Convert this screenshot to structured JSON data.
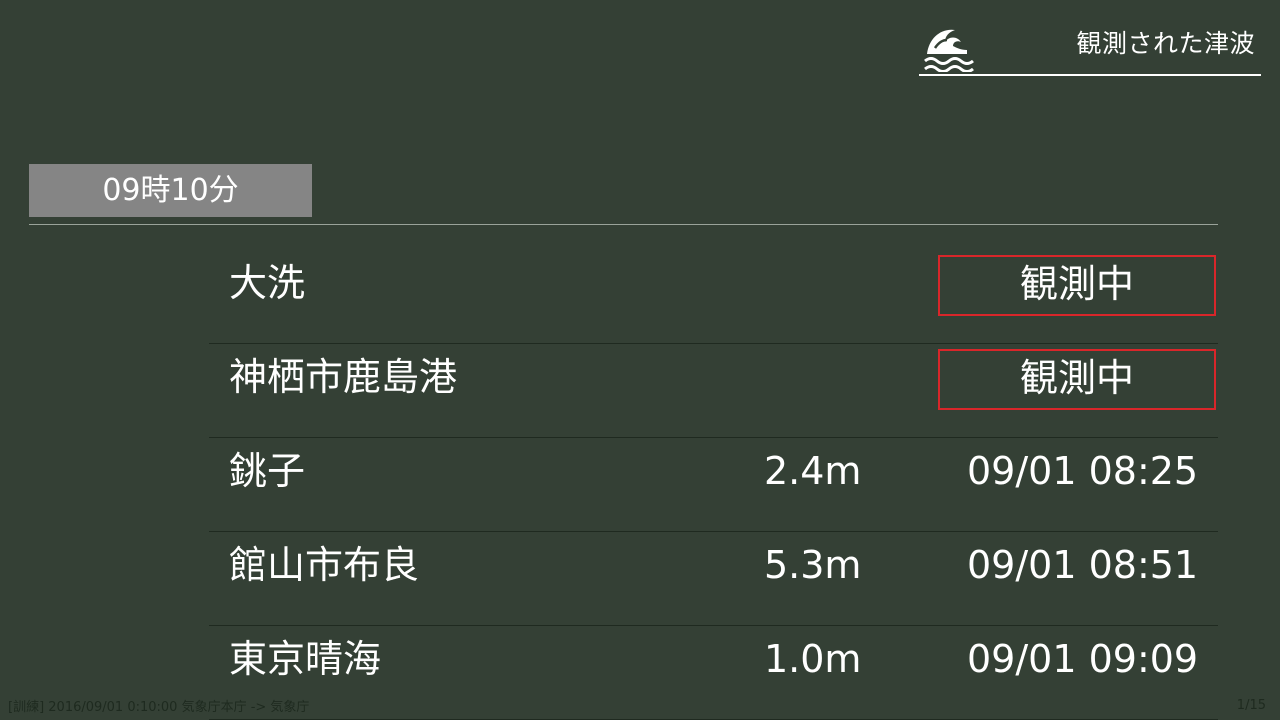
{
  "header": {
    "title": "観測された津波",
    "icon": "tsunami-wave-icon"
  },
  "time_label": "09時10分",
  "rows": [
    {
      "place": "大洗",
      "status": "観測中"
    },
    {
      "place": "神栖市鹿島港",
      "status": "観測中"
    },
    {
      "place": "銚子",
      "height": "2.4m",
      "time": "09/01 08:25"
    },
    {
      "place": "館山市布良",
      "height": "5.3m",
      "time": "09/01 08:51"
    },
    {
      "place": "東京晴海",
      "height": "1.0m",
      "time": "09/01 09:09"
    }
  ],
  "footer": {
    "info": "[訓練] 2016/09/01 0:10:00 気象庁本庁 -> 気象庁",
    "page": "1/15"
  },
  "colors": {
    "background": "#344035",
    "status_border": "#d9262a",
    "time_badge": "#858585"
  }
}
